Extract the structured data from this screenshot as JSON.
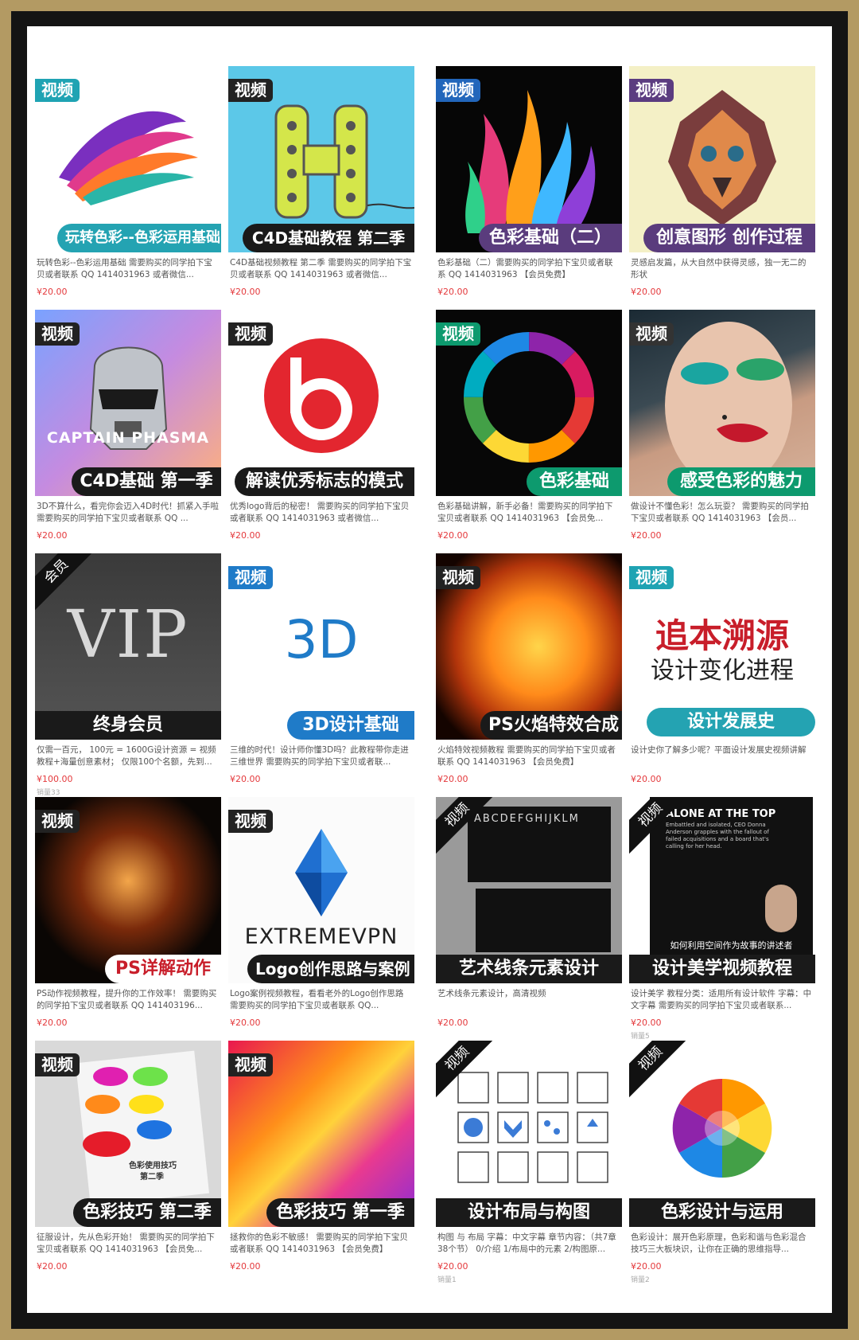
{
  "items": [
    {
      "badge": "视频",
      "title": "玩转色彩--色彩运用基础",
      "desc": "玩转色彩--色彩运用基础 需要购买的同学拍下宝贝或者联系 QQ 1414031963 或者微信...",
      "price": "¥20.00",
      "sales": ""
    },
    {
      "badge": "视频",
      "title": "C4D基础教程 第二季",
      "desc": "C4D基础视频教程 第二季 需要购买的同学拍下宝贝或者联系 QQ 1414031963 或者微信...",
      "price": "¥20.00",
      "sales": ""
    },
    {
      "badge": "视频",
      "title": "色彩基础（二）",
      "desc": "色彩基础（二）需要购买的同学拍下宝贝或者联系 QQ 1414031963 【会员免费】",
      "price": "¥20.00",
      "sales": ""
    },
    {
      "badge": "视频",
      "title": "创意图形 创作过程",
      "desc": "灵感启发篇，从大自然中获得灵感，独一无二的形状",
      "price": "¥20.00",
      "sales": ""
    },
    {
      "badge": "视频",
      "title": "C4D基础 第一季",
      "art_text": "CAPTAIN PHASMA",
      "desc": "3D不算什么，看完你会迈入4D时代！抓紧入手啦 需要购买的同学拍下宝贝或者联系 QQ ...",
      "price": "¥20.00",
      "sales": ""
    },
    {
      "badge": "视频",
      "title": "解读优秀标志的模式",
      "desc": "优秀logo背后的秘密！ 需要购买的同学拍下宝贝或者联系 QQ 1414031963 或者微信...",
      "price": "¥20.00",
      "sales": ""
    },
    {
      "badge": "视频",
      "title": "色彩基础",
      "desc": "色彩基础讲解，新手必备！需要购买的同学拍下宝贝或者联系 QQ 1414031963 【会员免...",
      "price": "¥20.00",
      "sales": ""
    },
    {
      "badge": "视频",
      "title": "感受色彩的魅力",
      "desc": "做设计不懂色彩！怎么玩耍？ 需要购买的同学拍下宝贝或者联系 QQ 1414031963 【会员...",
      "price": "¥20.00",
      "sales": ""
    },
    {
      "badge": "会员",
      "title": "终身会员",
      "art_text": "VIP",
      "desc": "仅需一百元， 100元 = 1600G设计资源 = 视频教程+海量创意素材； 仅限100个名额，先到...",
      "price": "¥100.00",
      "sales": "销量33"
    },
    {
      "badge": "视频",
      "title": "3D设计基础",
      "art_text": "3D",
      "desc": "三维的时代！设计师你懂3D吗？此教程带你走进三维世界 需要购买的同学拍下宝贝或者联...",
      "price": "¥20.00",
      "sales": ""
    },
    {
      "badge": "视频",
      "title": "PS火焰特效合成",
      "desc": "火焰特效视频教程 需要购买的同学拍下宝贝或者联系 QQ 1414031963 【会员免费】",
      "price": "¥20.00",
      "sales": ""
    },
    {
      "badge": "视频",
      "title": "设计发展史",
      "art_text": "追本溯源",
      "art_text2": "设计变化进程",
      "desc": "设计史你了解多少呢？平面设计发展史视频讲解",
      "price": "¥20.00",
      "sales": ""
    },
    {
      "badge": "视频",
      "title": "PS详解动作",
      "desc": "PS动作视频教程，提升你的工作效率！ 需要购买的同学拍下宝贝或者联系 QQ 141403196...",
      "price": "¥20.00",
      "sales": ""
    },
    {
      "badge": "视频",
      "title": "Logo创作思路与案例",
      "art_text": "EXTREMEVPN",
      "desc": "Logo案例视频教程，看看老外的Logo创作思路 需要购买的同学拍下宝贝或者联系 QQ...",
      "price": "¥20.00",
      "sales": ""
    },
    {
      "badge": "视频",
      "title": "艺术线条元素设计",
      "art_text": "ABCDEFGHIJKLM",
      "desc": "艺术线条元素设计，高清视频",
      "price": "¥20.00",
      "sales": ""
    },
    {
      "badge": "视频",
      "title": "设计美学视频教程",
      "art_text": "ALONE AT THE TOP",
      "art_text2": "Embattled and isolated, CEO Donna Anderson grapples with the fallout of failed acquisitions and a board that's calling for her head.",
      "art_text3": "如何利用空间作为故事的讲述者",
      "desc": "设计美学 教程分类：适用所有设计软件 字幕：中文字幕 需要购买的同学拍下宝贝或者联系...",
      "price": "¥20.00",
      "sales": "销量5"
    },
    {
      "badge": "视频",
      "title": "色彩技巧 第二季",
      "art_text": "色彩使用技巧",
      "art_text2": "第二季",
      "desc": "征服设计，先从色彩开始！ 需要购买的同学拍下宝贝或者联系 QQ 1414031963 【会员免...",
      "price": "¥20.00",
      "sales": ""
    },
    {
      "badge": "视频",
      "title": "色彩技巧 第一季",
      "desc": "拯救你的色彩不敏感！ 需要购买的同学拍下宝贝或者联系 QQ 1414031963 【会员免费】",
      "price": "¥20.00",
      "sales": ""
    },
    {
      "badge": "视频",
      "title": "设计布局与构图",
      "desc": "构图 与 布局 字幕：中文字幕 章节内容：（共7章38个节） 0/介绍 1/布局中的元素 2/构图原...",
      "price": "¥20.00",
      "sales": "销量1"
    },
    {
      "badge": "视频",
      "title": "色彩设计与运用",
      "desc": "色彩设计：展开色彩原理，色彩和谐与色彩混合技巧三大板块识，让你在正确的思维指导...",
      "price": "¥20.00",
      "sales": "销量2"
    }
  ]
}
